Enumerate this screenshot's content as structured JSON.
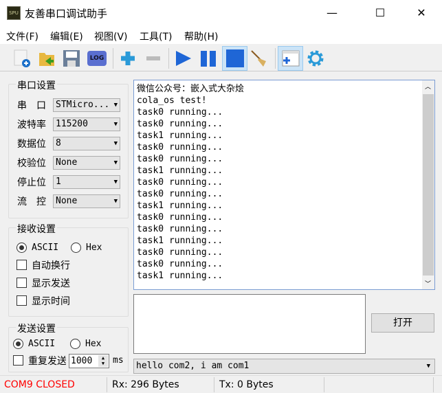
{
  "window": {
    "title": "友善串口调试助手",
    "icon_text": "SPU",
    "minimize": "—",
    "maximize": "☐",
    "close": "✕"
  },
  "menu": [
    "文件(F)",
    "编辑(E)",
    "视图(V)",
    "工具(T)",
    "帮助(H)"
  ],
  "toolbar": {
    "log_label": "LOG"
  },
  "serial_settings": {
    "title": "串口设置",
    "rows": [
      {
        "label": "串　口",
        "value": "STMicro..."
      },
      {
        "label": "波特率",
        "value": "115200"
      },
      {
        "label": "数据位",
        "value": "8"
      },
      {
        "label": "校验位",
        "value": "None"
      },
      {
        "label": "停止位",
        "value": "1"
      },
      {
        "label": "流　控",
        "value": "None"
      }
    ]
  },
  "receive_settings": {
    "title": "接收设置",
    "ascii": "ASCII",
    "hex": "Hex",
    "mode": "ASCII",
    "auto_wrap": "自动换行",
    "show_send": "显示发送",
    "show_time": "显示时间"
  },
  "send_settings": {
    "title": "发送设置",
    "ascii": "ASCII",
    "hex": "Hex",
    "mode": "ASCII",
    "repeat": "重复发送",
    "interval": "1000",
    "unit": "ms"
  },
  "receive_text": [
    "微信公众号：嵌入式大杂烩",
    "cola_os test!",
    "task0 running...",
    "task0 running...",
    "task1 running...",
    "task0 running...",
    "task0 running...",
    "task1 running...",
    "task0 running...",
    "task0 running...",
    "task1 running...",
    "task0 running...",
    "task0 running...",
    "task1 running...",
    "task0 running...",
    "task0 running...",
    "task1 running..."
  ],
  "open_button": "打开",
  "send_history": "hello com2, i am com1",
  "status": {
    "port": "COM9 CLOSED",
    "rx": "Rx: 296 Bytes",
    "tx": "Tx: 0 Bytes",
    "port_color": "#ff0000"
  }
}
